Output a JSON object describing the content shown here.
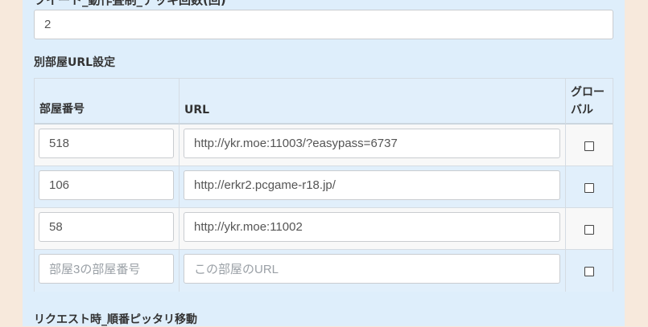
{
  "top_field": {
    "label": "ツイート_動作畳制_デッキ回数(回)",
    "value": "2"
  },
  "room_url_section": {
    "label": "別部屋URL設定",
    "columns": {
      "room_number": "部屋番号",
      "url": "URL",
      "global_line1": "グロー",
      "global_line2": "バル"
    },
    "rows": [
      {
        "room_number": "518",
        "url": "http://ykr.moe:11003/?easypass=6737",
        "global_checked": false
      },
      {
        "room_number": "106",
        "url": "http://erkr2.pcgame-r18.jp/",
        "global_checked": false
      },
      {
        "room_number": "58",
        "url": "http://ykr.moe:11002",
        "global_checked": false
      },
      {
        "room_number_placeholder": "部屋3の部屋番号",
        "url_placeholder": "この部屋のURL",
        "global_checked": false
      }
    ]
  },
  "next_section": {
    "label": "リクエスト時_順番ピッタリ移動"
  }
}
